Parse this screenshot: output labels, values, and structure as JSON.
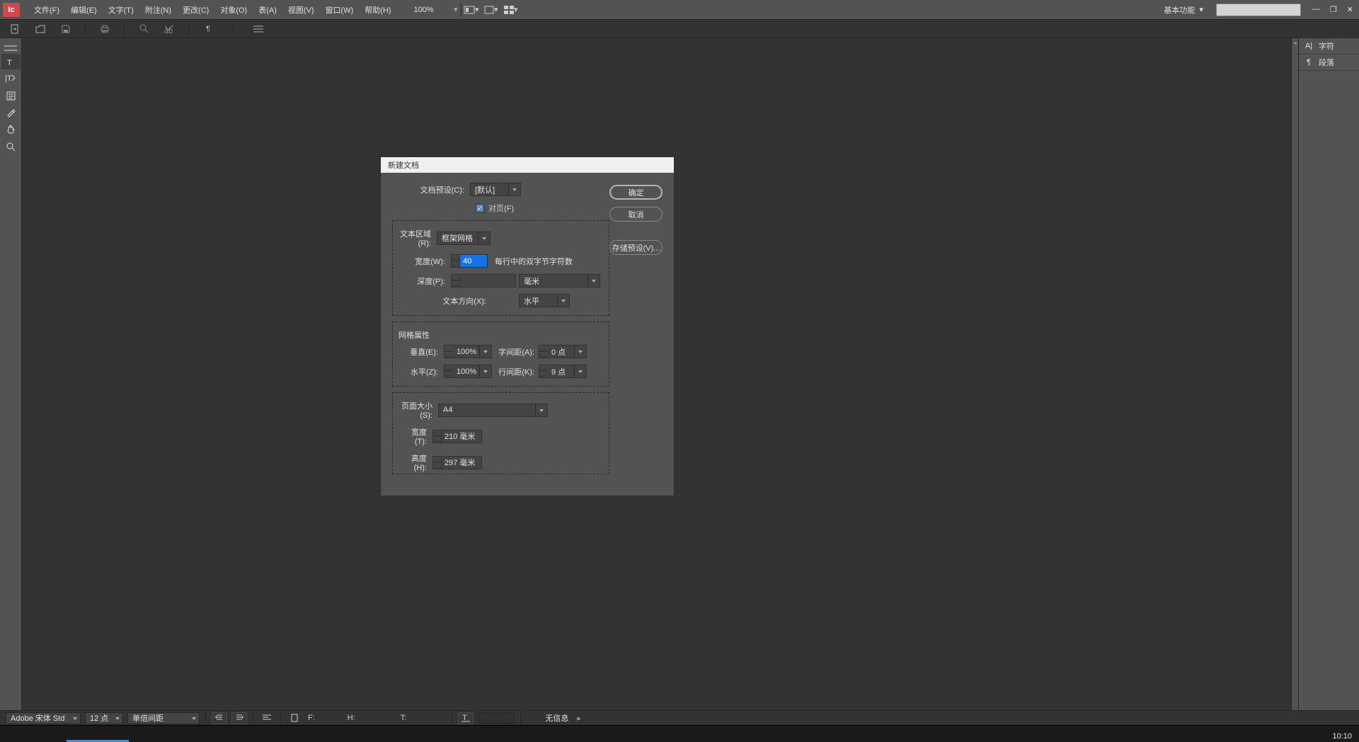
{
  "menubar": {
    "items": [
      "文件(F)",
      "编辑(E)",
      "文字(T)",
      "附注(N)",
      "更改(C)",
      "对象(O)",
      "表(A)",
      "视图(V)",
      "窗口(W)",
      "帮助(H)"
    ],
    "zoom": "100%",
    "workspace": "基本功能"
  },
  "rightPanel": {
    "tabs": [
      {
        "icon": "A|",
        "label": "字符"
      },
      {
        "icon": "¶",
        "label": "段落"
      }
    ]
  },
  "dialog": {
    "title": "新建文档",
    "presetLabel": "文档预设(C):",
    "presetValue": "[默认]",
    "facingPagesLabel": "对页(F)",
    "textAreaLabel": "文本区域(R):",
    "textAreaValue": "框架网格",
    "widthLabel": "宽度(W):",
    "widthValue": "40",
    "widthHelper": "每行中的双字节字符数",
    "depthLabel": "深度(P):",
    "depthValue": "",
    "depthUnit": "毫米",
    "textDirLabel": "文本方向(X):",
    "textDirValue": "水平",
    "gridTitle": "网格属性",
    "verticalLabel": "垂直(E):",
    "verticalValue": "100%",
    "horizLabel": "水平(Z):",
    "horizValue": "100%",
    "charSpaceLabel": "字间距(A):",
    "charSpaceValue": "0 点",
    "lineSpaceLabel": "行间距(K):",
    "lineSpaceValue": "9 点",
    "pageSizeLabel": "页面大小(S):",
    "pageSizeValue": "A4",
    "pageWidthLabel": "宽度(T):",
    "pageWidthValue": "210 毫米",
    "pageHeightLabel": "高度(H):",
    "pageHeightValue": "297 毫米",
    "okBtn": "确定",
    "cancelBtn": "取消",
    "savePresetBtn": "存储预设(V)..."
  },
  "statusbar": {
    "font": "Adobe 宋体 Std",
    "size": "12 点",
    "lineSpacing": "单倍间距",
    "f": "F:",
    "h": "H:",
    "t": "T:",
    "noInfo": "无信息"
  },
  "clock": "10:10"
}
